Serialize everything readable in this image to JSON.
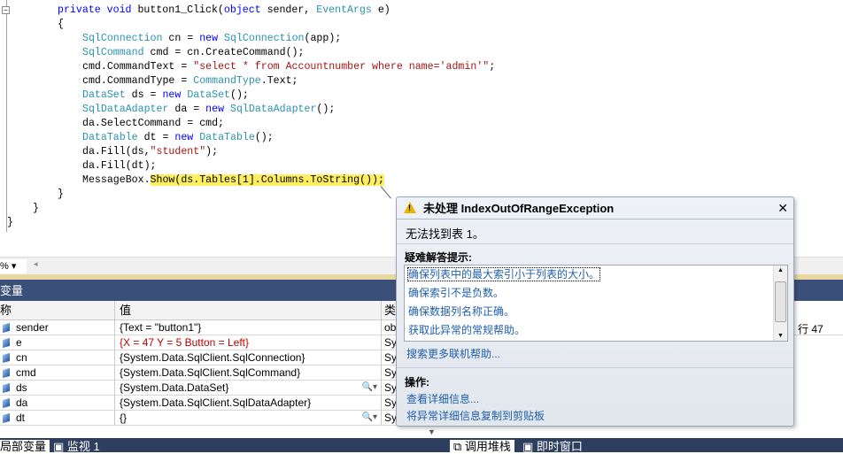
{
  "editor": {
    "lines": [
      {
        "indent": 65,
        "tokens": [
          [
            "private void ",
            "kw"
          ],
          [
            "button1_Click(",
            "pl"
          ],
          [
            "object ",
            "kw"
          ],
          [
            "sender, ",
            "pl"
          ],
          [
            "EventArgs ",
            "ty"
          ],
          [
            "e)",
            "pl"
          ]
        ]
      },
      {
        "indent": 65,
        "tokens": [
          [
            "{",
            "pl"
          ]
        ]
      },
      {
        "indent": 93,
        "tokens": [
          [
            "SqlConnection ",
            "ty"
          ],
          [
            "cn = ",
            "pl"
          ],
          [
            "new ",
            "kw"
          ],
          [
            "SqlConnection",
            "ty"
          ],
          [
            "(app);",
            "pl"
          ]
        ]
      },
      {
        "indent": 93,
        "tokens": [
          [
            "SqlCommand ",
            "ty"
          ],
          [
            "cmd = cn.CreateCommand();",
            "pl"
          ]
        ]
      },
      {
        "indent": 93,
        "tokens": [
          [
            "cmd.CommandText = ",
            "pl"
          ],
          [
            "\"select * from Accountnumber where name='admin'\"",
            "st"
          ],
          [
            ";",
            "pl"
          ]
        ]
      },
      {
        "indent": 93,
        "tokens": [
          [
            "cmd.CommandType = ",
            "pl"
          ],
          [
            "CommandType",
            "ty"
          ],
          [
            ".Text;",
            "pl"
          ]
        ]
      },
      {
        "indent": 93,
        "tokens": [
          [
            "DataSet ",
            "ty"
          ],
          [
            "ds = ",
            "pl"
          ],
          [
            "new ",
            "kw"
          ],
          [
            "DataSet",
            "ty"
          ],
          [
            "();",
            "pl"
          ]
        ]
      },
      {
        "indent": 93,
        "tokens": [
          [
            "SqlDataAdapter ",
            "ty"
          ],
          [
            "da = ",
            "pl"
          ],
          [
            "new ",
            "kw"
          ],
          [
            "SqlDataAdapter",
            "ty"
          ],
          [
            "();",
            "pl"
          ]
        ]
      },
      {
        "indent": 93,
        "tokens": [
          [
            "da.SelectCommand = cmd;",
            "pl"
          ]
        ]
      },
      {
        "indent": 93,
        "tokens": [
          [
            "DataTable ",
            "ty"
          ],
          [
            "dt = ",
            "pl"
          ],
          [
            "new ",
            "kw"
          ],
          [
            "DataTable",
            "ty"
          ],
          [
            "();",
            "pl"
          ]
        ]
      },
      {
        "indent": 93,
        "tokens": [
          [
            "da.Fill(ds,",
            "pl"
          ],
          [
            "\"student\"",
            "st"
          ],
          [
            ");",
            "pl"
          ]
        ]
      },
      {
        "indent": 93,
        "tokens": [
          [
            "da.Fill(dt);",
            "pl"
          ]
        ]
      },
      {
        "indent": 93,
        "tokens": [
          [
            "MessageBox.",
            "pl"
          ],
          [
            "Show(ds.Tables[1].Columns.ToString());",
            "hl"
          ]
        ]
      },
      {
        "indent": 65,
        "tokens": [
          [
            "}",
            "pl"
          ]
        ]
      },
      {
        "indent": 37,
        "tokens": [
          [
            "}",
            "pl"
          ]
        ]
      },
      {
        "indent": 8,
        "tokens": [
          [
            "}",
            "pl"
          ]
        ]
      }
    ],
    "zoom_value": "%"
  },
  "locals": {
    "title": "变量",
    "columns": [
      "称",
      "值",
      "类"
    ],
    "rows": [
      {
        "name": "sender",
        "value": "{Text = \"button1\"}",
        "type": "ob",
        "changed": false,
        "inspect": false
      },
      {
        "name": "e",
        "value": "{X = 47 Y = 5 Button = Left}",
        "type": "Sy",
        "changed": true,
        "inspect": false
      },
      {
        "name": "cn",
        "value": "{System.Data.SqlClient.SqlConnection}",
        "type": "Sy",
        "changed": false,
        "inspect": false
      },
      {
        "name": "cmd",
        "value": "{System.Data.SqlClient.SqlCommand}",
        "type": "Sy",
        "changed": false,
        "inspect": false
      },
      {
        "name": "ds",
        "value": "{System.Data.DataSet}",
        "type": "Sy",
        "changed": false,
        "inspect": true
      },
      {
        "name": "da",
        "value": "{System.Data.SqlClient.SqlDataAdapter}",
        "type": "Sy",
        "changed": false,
        "inspect": false
      },
      {
        "name": "dt",
        "value": "{}",
        "type": "Sy",
        "changed": false,
        "inspect": true
      }
    ]
  },
  "call_stack": {
    "line_label": "行 47"
  },
  "bottom_tabs": [
    "局部变量",
    "监视 1",
    "调用堆栈",
    "即时窗口"
  ],
  "exception": {
    "title": "未处理 IndexOutOfRangeException",
    "message": "无法找到表 1。",
    "tips_label": "疑难解答提示:",
    "tips": [
      "确保列表中的最大索引小于列表的大小。",
      "确保索引不是负数。",
      "确保数据列名称正确。",
      "获取此异常的常规帮助。"
    ],
    "search_link": "搜索更多联机帮助...",
    "actions_label": "操作:",
    "actions": [
      "查看详细信息...",
      "将异常详细信息复制到剪贴板"
    ]
  },
  "colors": {
    "keyword": "#0000ff",
    "type": "#2b91af",
    "string": "#a31515",
    "highlight": "#ffee62",
    "panel_header": "#3b5078"
  }
}
